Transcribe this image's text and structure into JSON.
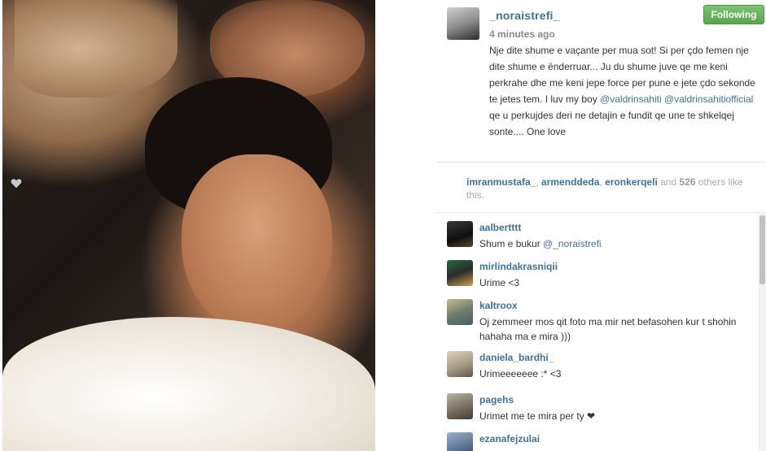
{
  "post": {
    "username": "_noraistrefi_",
    "timestamp": "4 minutes ago",
    "follow_label": "Following",
    "caption_text_1": "Nje dite shume e vaçante per mua sot! Si per çdo femen nje dite shume e ënderruar... Ju du shume juve qe me keni perkrahe dhe me keni jepe force per pune e jete çdo sekonde te jetes tem. I luv my boy ",
    "caption_mention_1": "@valdrinsahiti",
    "caption_mention_2": "@valdrinsahitiofficial",
    "caption_text_2": " qe u perkujdes deri ne detajin e fundit qe une te shkelqej sonte.... One love"
  },
  "likes": {
    "likers": [
      "imranmustafa_",
      "armenddeda",
      "eronkerqeli"
    ],
    "sep_1": ", ",
    "sep_2": ", ",
    "and_label": " and ",
    "count": "526",
    "others_label": " others like this."
  },
  "comments": [
    {
      "user": "aalbertttt",
      "text": "Shum e bukur ",
      "mention": "@_noraistrefi"
    },
    {
      "user": "mirlindakrasniqii",
      "text": "Urime <3"
    },
    {
      "user": "kaltroox",
      "text": "Oj zemmeer mos qit foto ma mir net befasohen kur t shohin hahaha ma e mira )))"
    },
    {
      "user": "daniela_bardhi_",
      "text": "Urimeeeeeee :* <3"
    },
    {
      "user": "pagehs",
      "text": "Urimet me te mira per ty ❤"
    },
    {
      "user": "ezanafejzulai",
      "text": ""
    }
  ],
  "colors": {
    "accent": "#3f729b",
    "follow_green": "#5ba64f"
  },
  "icons": {
    "heart": "heart-icon"
  }
}
